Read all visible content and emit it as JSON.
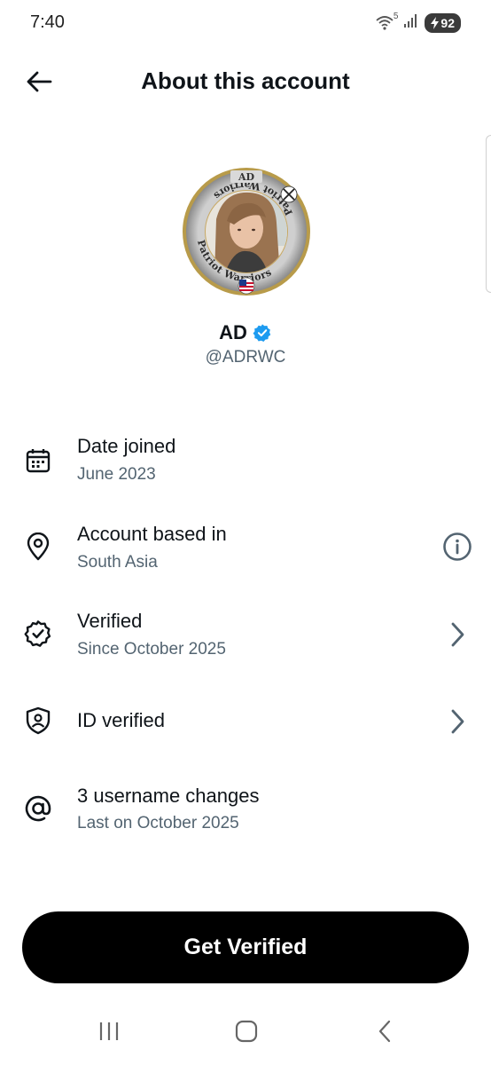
{
  "status_bar": {
    "time": "7:40",
    "battery": "92",
    "network": "5"
  },
  "header": {
    "title": "About this account"
  },
  "profile": {
    "name": "AD",
    "handle": "@ADRWC",
    "avatar_ring_text": "Patriot Warriors",
    "avatar_top_text": "AD",
    "verified_color": "#1d9bf0"
  },
  "rows": [
    {
      "icon": "calendar-icon",
      "title": "Date joined",
      "subtitle": "June 2023",
      "action": null
    },
    {
      "icon": "location-pin-icon",
      "title": "Account based in",
      "subtitle": "South Asia",
      "action": "info-icon"
    },
    {
      "icon": "verified-badge-icon",
      "title": "Verified",
      "subtitle": "Since October 2025",
      "action": "chevron-right-icon"
    },
    {
      "icon": "id-shield-icon",
      "title": "ID verified",
      "subtitle": "",
      "action": "chevron-right-icon"
    },
    {
      "icon": "at-sign-icon",
      "title": "3 username changes",
      "subtitle": "Last on October 2025",
      "action": null
    }
  ],
  "cta": {
    "label": "Get Verified"
  },
  "nav": [
    "recent-apps-icon",
    "home-icon",
    "back-icon"
  ],
  "colors": {
    "primary_text": "#0f1419",
    "secondary_text": "#536471",
    "accent": "#1d9bf0",
    "button_bg": "#000000"
  }
}
